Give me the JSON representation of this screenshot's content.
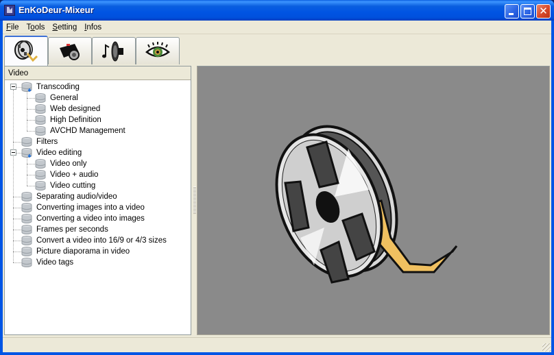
{
  "window": {
    "title": "EnKoDeur-Mixeur",
    "controls": {
      "minimize": "minimize",
      "maximize": "maximize",
      "close": "✕"
    }
  },
  "menu": [
    {
      "label": "File",
      "accel": "F",
      "rest": "ile"
    },
    {
      "label": "Tools",
      "accel": "o",
      "pre": "T",
      "rest": "ols"
    },
    {
      "label": "Setting",
      "accel": "S",
      "rest": "etting"
    },
    {
      "label": "Infos",
      "accel": "I",
      "rest": "nfos"
    }
  ],
  "tabs": [
    {
      "name": "video",
      "icon": "film-reel-icon",
      "active": true
    },
    {
      "name": "photo",
      "icon": "camera-icon",
      "active": false
    },
    {
      "name": "audio",
      "icon": "music-speaker-icon",
      "active": false
    },
    {
      "name": "view",
      "icon": "eye-icon",
      "active": false
    }
  ],
  "tree": {
    "header": "Video",
    "items": [
      {
        "label": "Transcoding",
        "level": 0,
        "expanded": true,
        "has_children": true
      },
      {
        "label": "General",
        "level": 1
      },
      {
        "label": "Web designed",
        "level": 1
      },
      {
        "label": "High Definition",
        "level": 1
      },
      {
        "label": "AVCHD Management",
        "level": 1,
        "last": true
      },
      {
        "label": "Filters",
        "level": 0
      },
      {
        "label": "Video editing",
        "level": 0,
        "expanded": true,
        "has_children": true
      },
      {
        "label": "Video only",
        "level": 1
      },
      {
        "label": "Video + audio",
        "level": 1
      },
      {
        "label": "Video cutting",
        "level": 1,
        "last": true
      },
      {
        "label": "Separating audio/video",
        "level": 0
      },
      {
        "label": "Converting images into a video",
        "level": 0
      },
      {
        "label": "Converting a video into images",
        "level": 0
      },
      {
        "label": "Frames per seconds",
        "level": 0
      },
      {
        "label": "Convert a video into 16/9 or 4/3 sizes",
        "level": 0
      },
      {
        "label": "Picture diaporama in video",
        "level": 0
      },
      {
        "label": "Video tags",
        "level": 0,
        "last": true
      }
    ]
  },
  "preview": {
    "image": "film-reel-illustration",
    "background": "#8a8a8a"
  },
  "colors": {
    "titlebar": "#0054e3",
    "client": "#ece9d8",
    "film": "#f0c060"
  }
}
